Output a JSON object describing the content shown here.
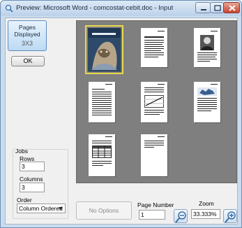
{
  "window": {
    "title": "Preview: Microsoft Word - comcostat-cebit.doc - Input"
  },
  "pages_displayed": {
    "line1": "Pages",
    "line2": "Displayed",
    "grid": "3X3"
  },
  "ok_label": "OK",
  "jobs": {
    "title": "Jobs",
    "rows_label": "Rows",
    "rows_value": "3",
    "columns_label": "Columns",
    "columns_value": "3",
    "order_label": "Order",
    "order_value": "Column Ordered"
  },
  "no_options_label": "No Options",
  "page_number": {
    "label": "Page Number",
    "value": "1"
  },
  "zoom": {
    "label": "Zoom",
    "value": "33.333%"
  },
  "colors": {
    "preview_bg": "#7f7f7f",
    "selected_outline": "#e8d84a",
    "title_gradient": "#bcd2ea"
  },
  "icons": [
    "app-preview-icon",
    "minimize-icon",
    "maximize-icon",
    "close-icon",
    "zoom-out-icon",
    "zoom-in-icon"
  ]
}
